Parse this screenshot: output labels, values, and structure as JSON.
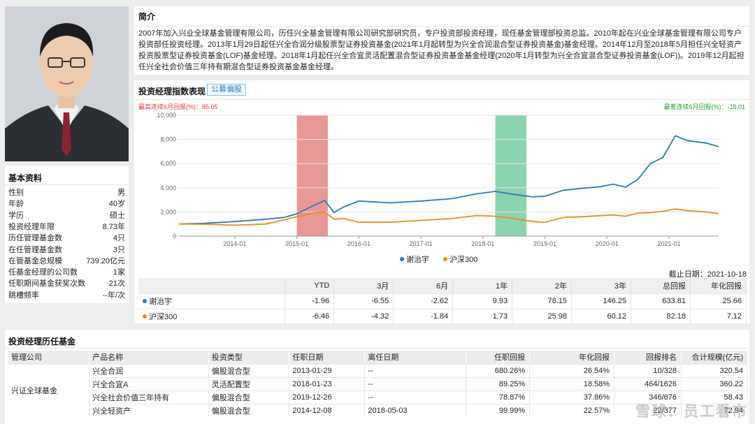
{
  "intro": {
    "title": "简介",
    "text": "2007年加入兴业全球基金管理有限公司，历任兴全基金管理有限公司研究部研究员，专户投资部投资经理，现任基金管理部投资总监。2010年起在兴业全球基金管理有限公司专户投资部任投资经理。2013年1月29日起任兴全合润分级股票型证券投资基金(2021年1月起转型为兴全合润混合型证券投资基金)基金经理。2014年12月至2018年5月担任兴全轻资产投资股票型证券投资基金(LOF)基金经理。2018年1月起任兴全合宜灵活配置混合型证券投资基金基金经理(2020年1月转型为兴全合宜混合型证券投资基金(LOF))。2019年12月起担任兴全社会价值三年持有期混合型证券投资基金基金经理。"
  },
  "basic": {
    "title": "基本资料",
    "rows": [
      {
        "k": "性别",
        "v": "男"
      },
      {
        "k": "年龄",
        "v": "40岁"
      },
      {
        "k": "学历",
        "v": "硕士"
      },
      {
        "k": "投资经理年限",
        "v": "8.73年"
      },
      {
        "k": "历任管理基金数",
        "v": "4只"
      },
      {
        "k": "在任管理基金数",
        "v": "3只"
      },
      {
        "k": "在管基金总规模",
        "v": "739.20亿元"
      },
      {
        "k": "任基金经理的公司数",
        "v": "1家"
      },
      {
        "k": "任职期间基金获奖次数",
        "v": "21次"
      },
      {
        "k": "跳槽频率",
        "v": "--年/次"
      }
    ]
  },
  "perf": {
    "title": "投资经理指数表现",
    "tag": "公募偏股",
    "best_dd": "最高连续6月回报(%)：85.05",
    "worst_dd": "最差连续6月回报(%)：-18.01",
    "as_of": "截止日期：2021-10-18",
    "colors": {
      "manager": "#2b7bb0",
      "index": "#f08a1c",
      "best": "#d9534f",
      "worst": "#3cb57a"
    },
    "legend": [
      "谢治宇",
      "沪深300"
    ],
    "table_headers": [
      "",
      "YTD",
      "3月",
      "6月",
      "1年",
      "2年",
      "3年",
      "总回报",
      "年化回报"
    ],
    "table_rows": [
      {
        "name": "谢治宇",
        "vals": [
          "-1.96",
          "-6.55",
          "-2.62",
          "9.93",
          "78.15",
          "146.25",
          "633.81",
          "25.66"
        ]
      },
      {
        "name": "沪深300",
        "vals": [
          "-6.46",
          "-4.32",
          "-1.84",
          "1.73",
          "25.98",
          "60.12",
          "82.18",
          "7.12"
        ]
      }
    ]
  },
  "chart_data": {
    "type": "line",
    "y_ticks": [
      "0",
      "2,000",
      "4,000",
      "6,000",
      "8,000",
      "10,000"
    ],
    "ylim": [
      0,
      10000
    ],
    "x_ticks": [
      "2014-01",
      "2015-01",
      "2016-01",
      "2017-01",
      "2018-01",
      "2019-01",
      "2020-01",
      "2021-01"
    ],
    "xlim": [
      2013.1,
      2021.8
    ],
    "best_period": [
      2015.0,
      2015.5
    ],
    "worst_period": [
      2018.2,
      2018.7
    ],
    "series": [
      {
        "name": "谢治宇",
        "x": [
          2013.1,
          2013.5,
          2014.0,
          2014.5,
          2014.8,
          2015.0,
          2015.3,
          2015.45,
          2015.6,
          2015.75,
          2016.0,
          2016.5,
          2017.0,
          2017.5,
          2017.9,
          2018.2,
          2018.5,
          2018.8,
          2019.0,
          2019.3,
          2019.6,
          2019.9,
          2020.1,
          2020.3,
          2020.5,
          2020.7,
          2020.9,
          2021.1,
          2021.3,
          2021.6,
          2021.8
        ],
        "y": [
          1000,
          1050,
          1200,
          1400,
          1550,
          1850,
          2600,
          2950,
          1950,
          2400,
          2900,
          2750,
          2900,
          3100,
          3500,
          3700,
          3450,
          3250,
          3300,
          3800,
          3950,
          4100,
          4300,
          4050,
          4700,
          6000,
          6500,
          8300,
          7900,
          7700,
          7400
        ]
      },
      {
        "name": "沪深300",
        "x": [
          2013.1,
          2013.5,
          2014.0,
          2014.5,
          2014.8,
          2015.0,
          2015.3,
          2015.45,
          2015.6,
          2015.75,
          2016.0,
          2016.5,
          2017.0,
          2017.5,
          2017.9,
          2018.2,
          2018.5,
          2018.8,
          2019.0,
          2019.3,
          2019.6,
          2019.9,
          2020.1,
          2020.3,
          2020.5,
          2020.7,
          2020.9,
          2021.1,
          2021.3,
          2021.6,
          2021.8
        ],
        "y": [
          1000,
          980,
          900,
          1000,
          1350,
          1600,
          1950,
          2000,
          1400,
          1450,
          1150,
          1150,
          1300,
          1450,
          1700,
          1650,
          1450,
          1200,
          1150,
          1550,
          1600,
          1700,
          1750,
          1650,
          1900,
          1950,
          2050,
          2250,
          2100,
          2000,
          1850
        ]
      }
    ]
  },
  "history": {
    "title": "投资经理历任基金",
    "headers": [
      "管理公司",
      "产品名称",
      "投资类型",
      "任职日期",
      "离任日期",
      "任职回报",
      "年化回报",
      "回报排名",
      "合计规模(亿元)"
    ],
    "company": "兴证全球基金",
    "rows": [
      [
        "兴全合润",
        "偏股混合型",
        "2013-01-29",
        "--",
        "680.26%",
        "26.54%",
        "10/328",
        "320.54"
      ],
      [
        "兴全合宜A",
        "灵活配置型",
        "2018-01-23",
        "--",
        "89.25%",
        "18.58%",
        "464/1626",
        "360.22"
      ],
      [
        "兴全社会价值三年持有",
        "偏股混合型",
        "2019-12-26",
        "--",
        "78.87%",
        "37.86%",
        "346/676",
        "58.43"
      ],
      [
        "兴全轻资产",
        "偏股混合型",
        "2014-12-08",
        "2018-05-03",
        "99.99%",
        "22.57%",
        "22/377",
        "72.94"
      ]
    ]
  },
  "watermark": "雪球：员工看市"
}
